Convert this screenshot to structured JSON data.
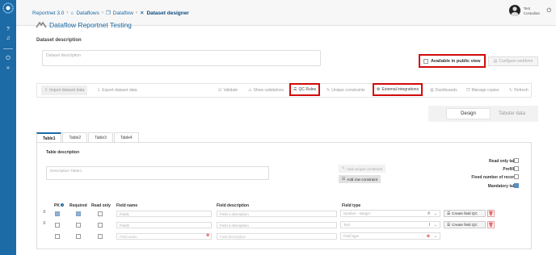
{
  "sidebar": {
    "icons": [
      "help-icon",
      "bell-icon",
      "power-icon",
      "chevrons-right-icon"
    ]
  },
  "breadcrumb": {
    "items": [
      "Reportnet 3.0",
      "Dataflows",
      "Dataflow",
      "Dataset designer"
    ]
  },
  "user": {
    "line1": "Test",
    "line2": "Custodian"
  },
  "header": {
    "dataflow_title": "Dataflow Reportnet Testing"
  },
  "dataset": {
    "description_label": "Dataset description",
    "description_placeholder": "Dataset description",
    "public_label": "Available in public view",
    "configure_webform": "Configure webform"
  },
  "toolbar": {
    "import": "Import dataset data",
    "export": "Export dataset data",
    "validate": "Validate",
    "show_validations": "Show validations",
    "qc_rules": "QC Rules",
    "unique_constraints": "Unique constraints",
    "external_integrations": "External integrations",
    "dashboards": "Dashboards",
    "manage_copies": "Manage copies",
    "refresh": "Refresh"
  },
  "view": {
    "design": "Design",
    "tabular": "Tabular data"
  },
  "tabs": [
    "Table1",
    "Table2",
    "Table3",
    "Table4"
  ],
  "table": {
    "description_label": "Table description",
    "description_placeholder": "Description Table1",
    "add_unique": "Add unique constraint",
    "add_row": "Add row constraint",
    "read_only": "Read only table",
    "prefilled": "Prefilled",
    "fixed_records": "Fixed number of records",
    "mandatory": "Mandatory table",
    "mandatory_checked": true
  },
  "fields": {
    "headers": {
      "pk": "PK",
      "required": "Required",
      "read_only": "Read only",
      "name": "Field name",
      "description": "Field description",
      "type": "Field type"
    },
    "rows": [
      {
        "name": "Field1",
        "description": "Field 1 description",
        "type": "Number - Integer",
        "type_icon": "#",
        "pk": true,
        "required": true,
        "read_only": false
      },
      {
        "name": "Field2",
        "description": "Field 2 description",
        "type": "Text",
        "type_icon": "I",
        "pk": false,
        "required": false,
        "read_only": false
      }
    ],
    "new_row": {
      "name": "Field name",
      "description": "Field description",
      "type": "Field type"
    },
    "create_qc": "Create field QC"
  }
}
